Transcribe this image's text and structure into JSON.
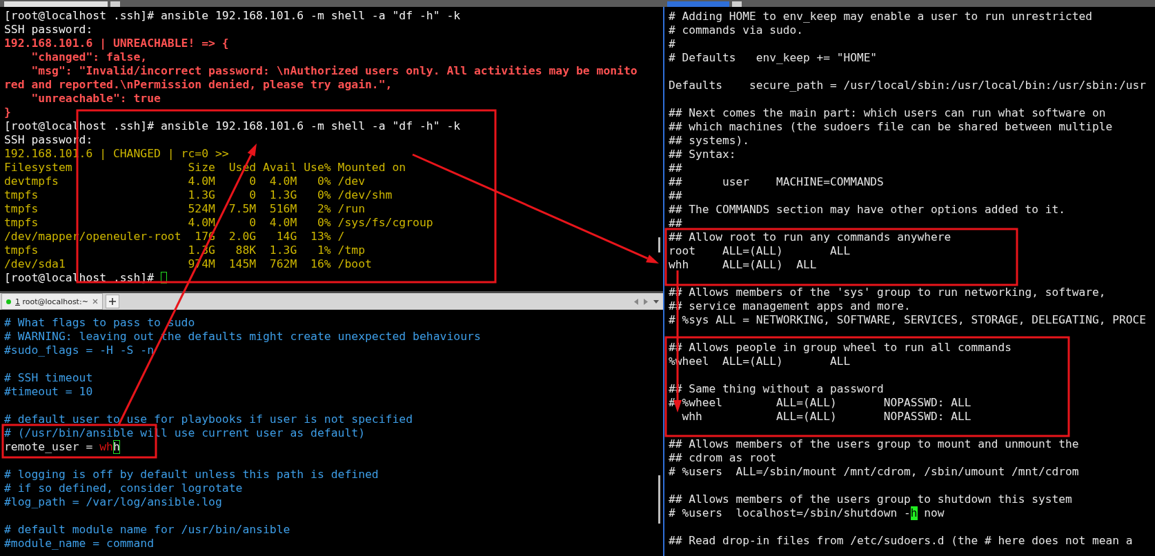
{
  "top_terminal": {
    "prompt_cursor": true,
    "lines": [
      {
        "kind": "prompt",
        "text": "[root@localhost .ssh]# ansible 192.168.101.6 -m shell -a \"df -h\" -k"
      },
      {
        "kind": "prompt",
        "text": "SSH password:"
      },
      {
        "kind": "error",
        "text": "192.168.101.6 | UNREACHABLE! => {"
      },
      {
        "kind": "error",
        "text": "    \"changed\": false,"
      },
      {
        "kind": "error",
        "text": "    \"msg\": \"Invalid/incorrect password: \\nAuthorized users only. All activities may be monito"
      },
      {
        "kind": "error",
        "text": "red and reported.\\nPermission denied, please try again.\","
      },
      {
        "kind": "error",
        "text": "    \"unreachable\": true"
      },
      {
        "kind": "error",
        "text": "}"
      },
      {
        "kind": "prompt",
        "text": "[root@localhost .ssh]# ansible 192.168.101.6 -m shell -a \"df -h\" -k"
      },
      {
        "kind": "prompt",
        "text": "SSH password:"
      },
      {
        "kind": "output",
        "text": "192.168.101.6 | CHANGED | rc=0 >>"
      },
      {
        "kind": "output",
        "text": "Filesystem                 Size  Used Avail Use% Mounted on"
      },
      {
        "kind": "output",
        "text": "devtmpfs                   4.0M     0  4.0M   0% /dev"
      },
      {
        "kind": "output",
        "text": "tmpfs                      1.3G     0  1.3G   0% /dev/shm"
      },
      {
        "kind": "output",
        "text": "tmpfs                      524M  7.5M  516M   2% /run"
      },
      {
        "kind": "output",
        "text": "tmpfs                      4.0M     0  4.0M   0% /sys/fs/cgroup"
      },
      {
        "kind": "output",
        "text": "/dev/mapper/openeuler-root  17G  2.0G   14G  13% /"
      },
      {
        "kind": "output",
        "text": "tmpfs                      1.3G   88K  1.3G   1% /tmp"
      },
      {
        "kind": "output",
        "text": "/dev/sda1                  974M  145M  762M  16% /boot"
      },
      {
        "kind": "prompt",
        "text": "[root@localhost .ssh]# "
      }
    ]
  },
  "bottom_tab_bar": {
    "tabs": [
      {
        "number": "1",
        "title": " root@localhost:~",
        "selected": true
      }
    ]
  },
  "bottom_terminal": {
    "lines": [
      {
        "kind": "comment",
        "text": "# What flags to pass to sudo"
      },
      {
        "kind": "comment",
        "text": "# WARNING: leaving out the defaults might create unexpected behaviours"
      },
      {
        "kind": "comment",
        "text": "#sudo_flags = -H -S -n"
      },
      {
        "kind": "blank"
      },
      {
        "kind": "comment",
        "text": "# SSH timeout"
      },
      {
        "kind": "comment",
        "text": "#timeout = 10"
      },
      {
        "kind": "blank"
      },
      {
        "kind": "comment",
        "text": "# default user to use for playbooks if user is not specified"
      },
      {
        "kind": "comment",
        "text": "# (/usr/bin/ansible will use current user as default)"
      },
      {
        "kind": "text",
        "segments": [
          {
            "kind": "text",
            "text": "remote_user = "
          },
          {
            "kind": "red",
            "text": "wh"
          },
          {
            "kind": "cursor-outline",
            "text": "h"
          }
        ]
      },
      {
        "kind": "blank"
      },
      {
        "kind": "comment",
        "text": "# logging is off by default unless this path is defined"
      },
      {
        "kind": "comment",
        "text": "# if so defined, consider logrotate"
      },
      {
        "kind": "comment",
        "text": "#log_path = /var/log/ansible.log"
      },
      {
        "kind": "blank"
      },
      {
        "kind": "comment",
        "text": "# default module name for /usr/bin/ansible"
      },
      {
        "kind": "comment",
        "text": "#module_name = command"
      }
    ]
  },
  "right_terminal": {
    "lines": [
      {
        "kind": "text",
        "text": "# Adding HOME to env_keep may enable a user to run unrestricted"
      },
      {
        "kind": "text",
        "text": "# commands via sudo."
      },
      {
        "kind": "text",
        "text": "#"
      },
      {
        "kind": "text",
        "text": "# Defaults   env_keep += \"HOME\""
      },
      {
        "kind": "blank"
      },
      {
        "kind": "text",
        "text": "Defaults    secure_path = /usr/local/sbin:/usr/local/bin:/usr/sbin:/usr"
      },
      {
        "kind": "blank"
      },
      {
        "kind": "text",
        "text": "## Next comes the main part: which users can run what software on"
      },
      {
        "kind": "text",
        "text": "## which machines (the sudoers file can be shared between multiple"
      },
      {
        "kind": "text",
        "text": "## systems)."
      },
      {
        "kind": "text",
        "text": "## Syntax:"
      },
      {
        "kind": "text",
        "text": "##"
      },
      {
        "kind": "text",
        "text": "##      user    MACHINE=COMMANDS"
      },
      {
        "kind": "text",
        "text": "##"
      },
      {
        "kind": "text",
        "text": "## The COMMANDS section may have other options added to it."
      },
      {
        "kind": "text",
        "text": "##"
      },
      {
        "kind": "text",
        "text": "## Allow root to run any commands anywhere"
      },
      {
        "kind": "text",
        "text": "root    ALL=(ALL)       ALL"
      },
      {
        "kind": "text",
        "text": "whh     ALL=(ALL)  ALL"
      },
      {
        "kind": "blank"
      },
      {
        "kind": "text",
        "text": "## Allows members of the 'sys' group to run networking, software,"
      },
      {
        "kind": "text",
        "text": "## service management apps and more."
      },
      {
        "kind": "text",
        "text": "# %sys ALL = NETWORKING, SOFTWARE, SERVICES, STORAGE, DELEGATING, PROCE"
      },
      {
        "kind": "blank"
      },
      {
        "kind": "text",
        "text": "## Allows people in group wheel to run all commands"
      },
      {
        "kind": "text",
        "text": "%wheel  ALL=(ALL)       ALL"
      },
      {
        "kind": "blank"
      },
      {
        "kind": "text",
        "text": "## Same thing without a password"
      },
      {
        "kind": "text",
        "text": "# %wheel        ALL=(ALL)       NOPASSWD: ALL"
      },
      {
        "kind": "text",
        "text": "  whh           ALL=(ALL)       NOPASSWD: ALL"
      },
      {
        "kind": "blank"
      },
      {
        "kind": "text",
        "text": "## Allows members of the users group to mount and unmount the"
      },
      {
        "kind": "text",
        "text": "## cdrom as root"
      },
      {
        "kind": "text",
        "text": "# %users  ALL=/sbin/mount /mnt/cdrom, /sbin/umount /mnt/cdrom"
      },
      {
        "kind": "blank"
      },
      {
        "kind": "text",
        "text": "## Allows members of the users group to shutdown this system"
      },
      {
        "kind": "text",
        "segments": [
          {
            "kind": "text",
            "text": "# %users  localhost=/sbin/shutdown -"
          },
          {
            "kind": "cursor-fill",
            "text": "h"
          },
          {
            "kind": "text",
            "text": " now"
          }
        ]
      },
      {
        "kind": "blank"
      },
      {
        "kind": "text",
        "text": "## Read drop-in files from /etc/sudoers.d (the # here does not mean a"
      }
    ]
  }
}
